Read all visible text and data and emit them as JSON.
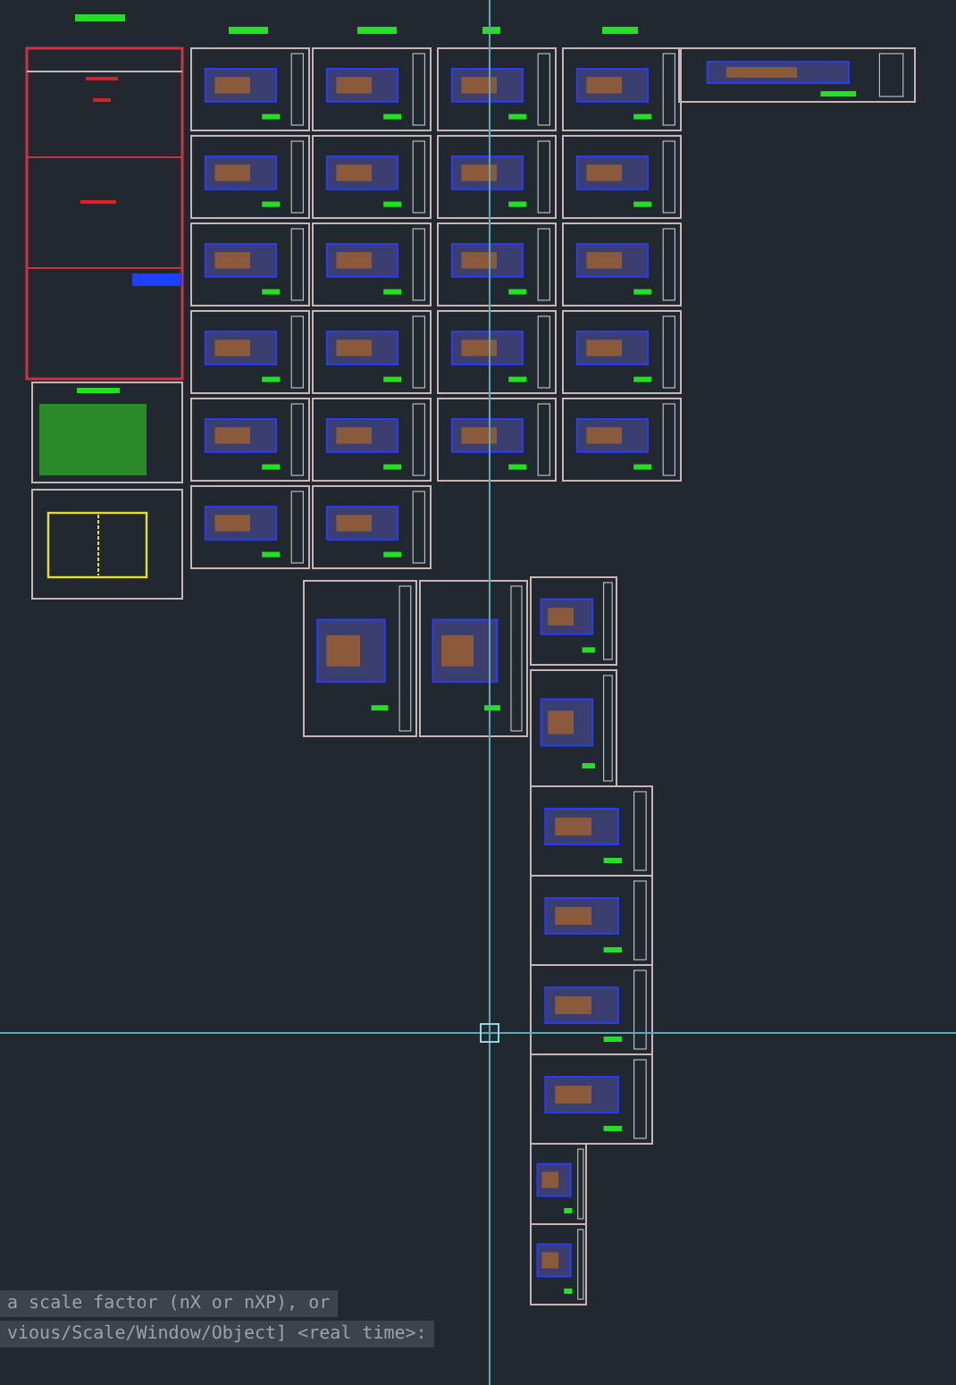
{
  "command_line": {
    "lines": [
      "a scale factor (nX or nXP), or",
      "vious/Scale/Window/Object] <real time>:"
    ]
  }
}
